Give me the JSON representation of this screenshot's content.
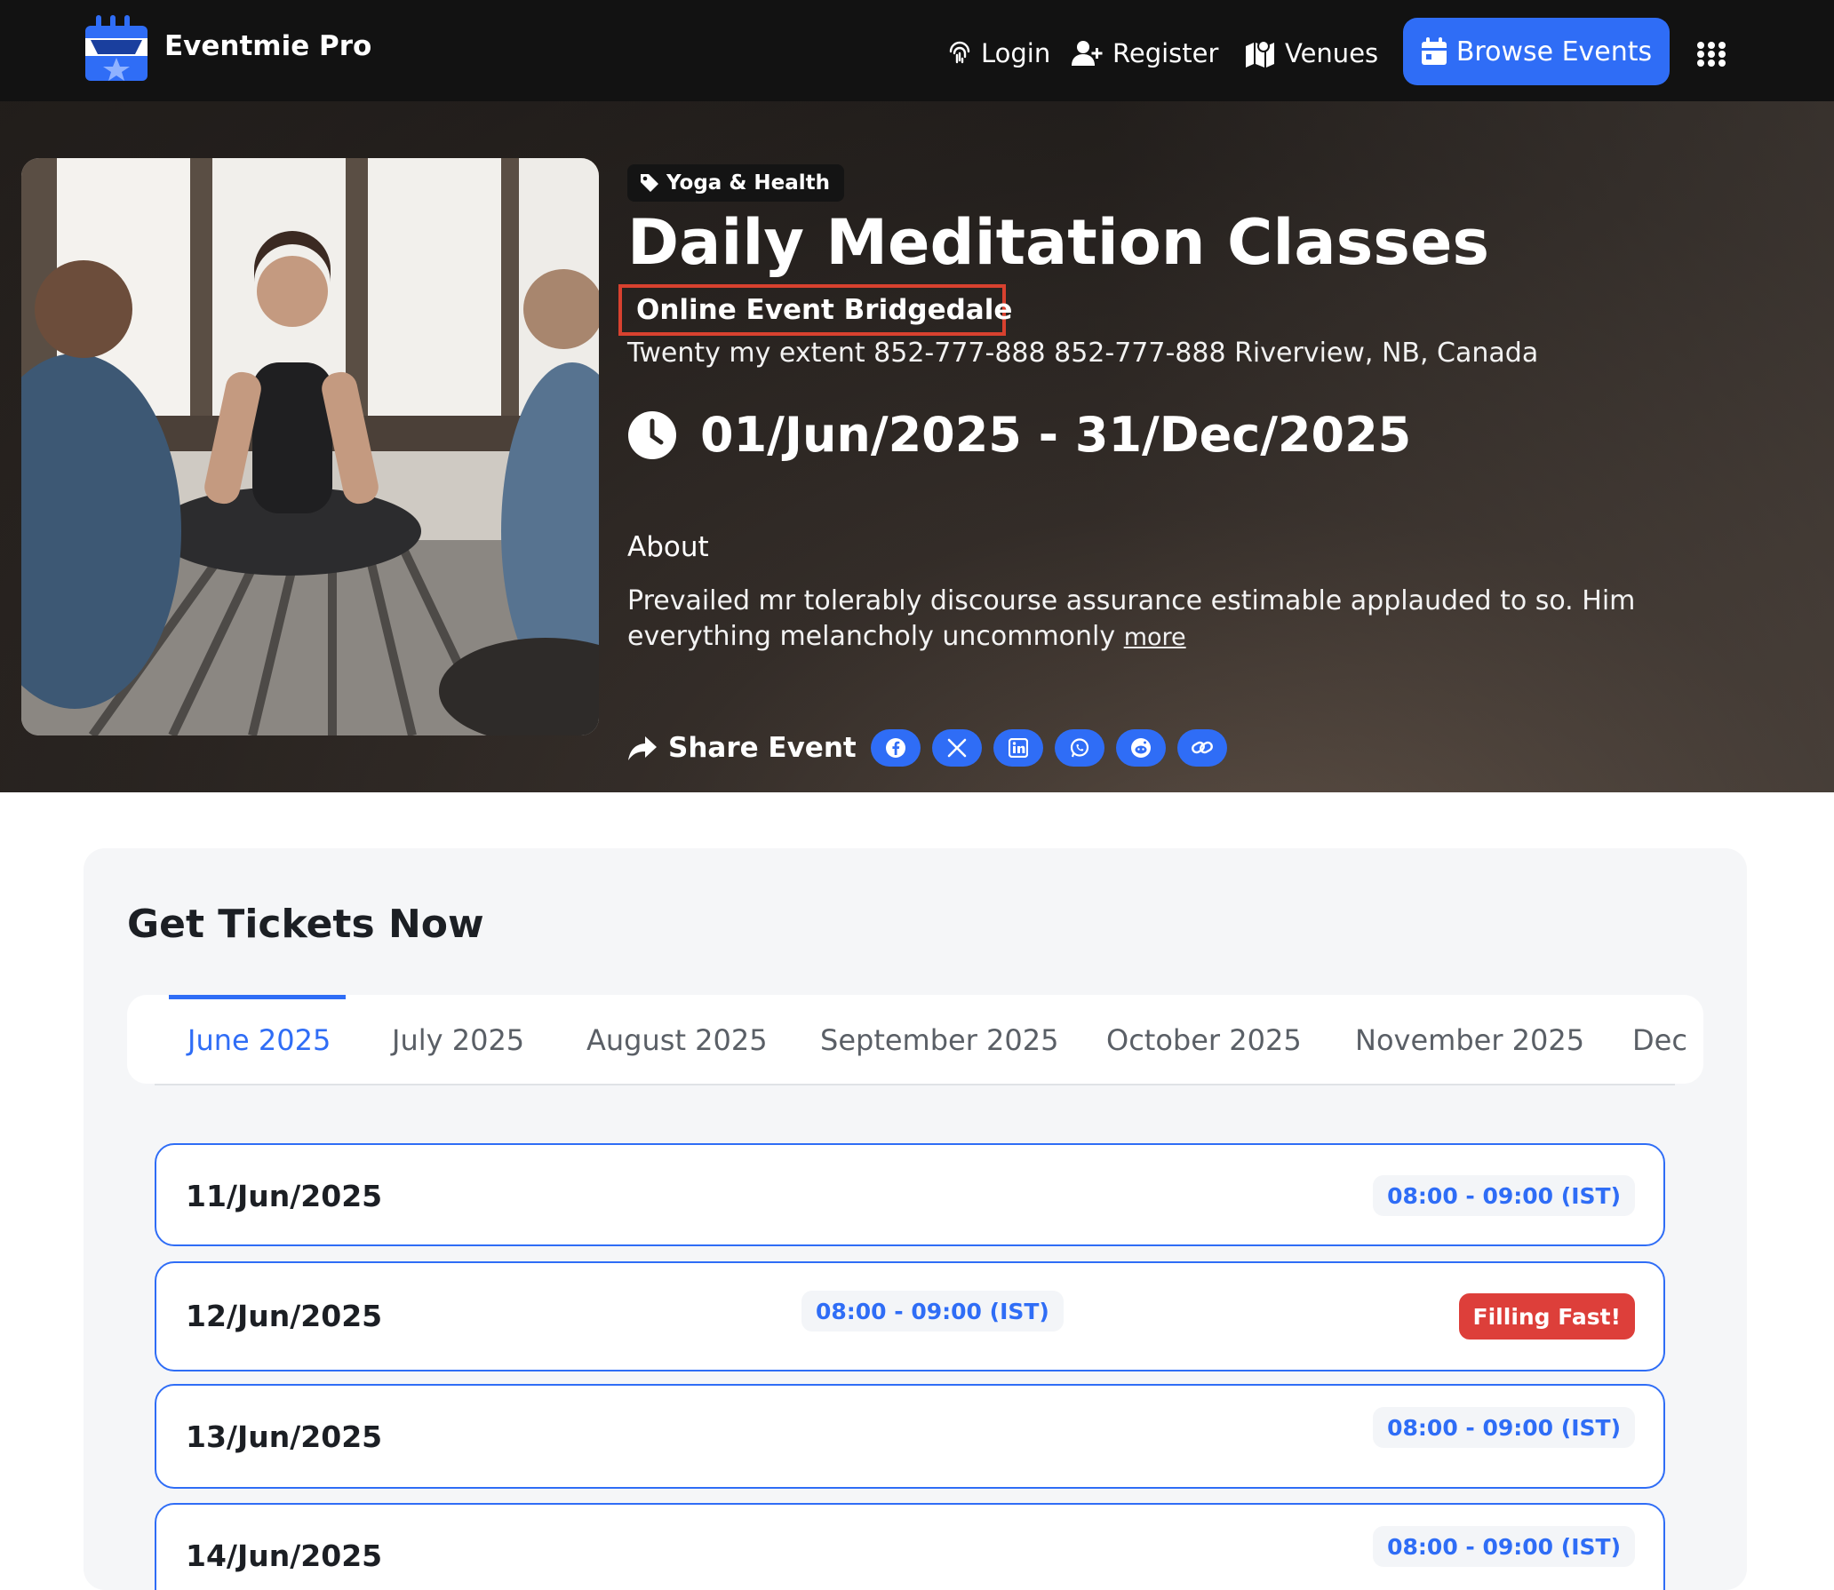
{
  "navbar": {
    "brand": "Eventmie Pro",
    "login": "Login",
    "register": "Register",
    "venues": "Venues",
    "browse_events": "Browse Events"
  },
  "event": {
    "category": "Yoga & Health",
    "title": "Daily Meditation Classes",
    "online_venue": "Online Event Bridgedale",
    "address": "Twenty my extent 852-777-888 852-777-888 Riverview, NB, Canada",
    "date_range": "01/Jun/2025 - 31/Dec/2025",
    "about_label": "About",
    "about_text": "Prevailed mr tolerably discourse assurance estimable applauded to so. Him everything melancholy uncommonly",
    "more_link": "more",
    "share_label": "Share Event",
    "share_icons": [
      "facebook-icon",
      "x-twitter-icon",
      "linkedin-icon",
      "whatsapp-icon",
      "reddit-icon",
      "copy-link-icon"
    ]
  },
  "tickets": {
    "heading": "Get Tickets Now",
    "tabs": [
      "June 2025",
      "July 2025",
      "August 2025",
      "September 2025",
      "October 2025",
      "November 2025",
      "Dec"
    ],
    "active_tab": "June 2025",
    "dates": [
      {
        "date": "11/Jun/2025",
        "time": "08:00 - 09:00 (IST)"
      },
      {
        "date": "12/Jun/2025",
        "time": "08:00 - 09:00 (IST)",
        "badge": "Filling Fast!"
      },
      {
        "date": "13/Jun/2025",
        "time": "08:00 - 09:00 (IST)"
      },
      {
        "date": "14/Jun/2025",
        "time": "08:00 - 09:00 (IST)"
      }
    ]
  },
  "colors": {
    "accent": "#2f6df6",
    "navbar_bg": "#121212",
    "badge_red": "#dd3f3a",
    "highlight_border": "#d8412f"
  }
}
